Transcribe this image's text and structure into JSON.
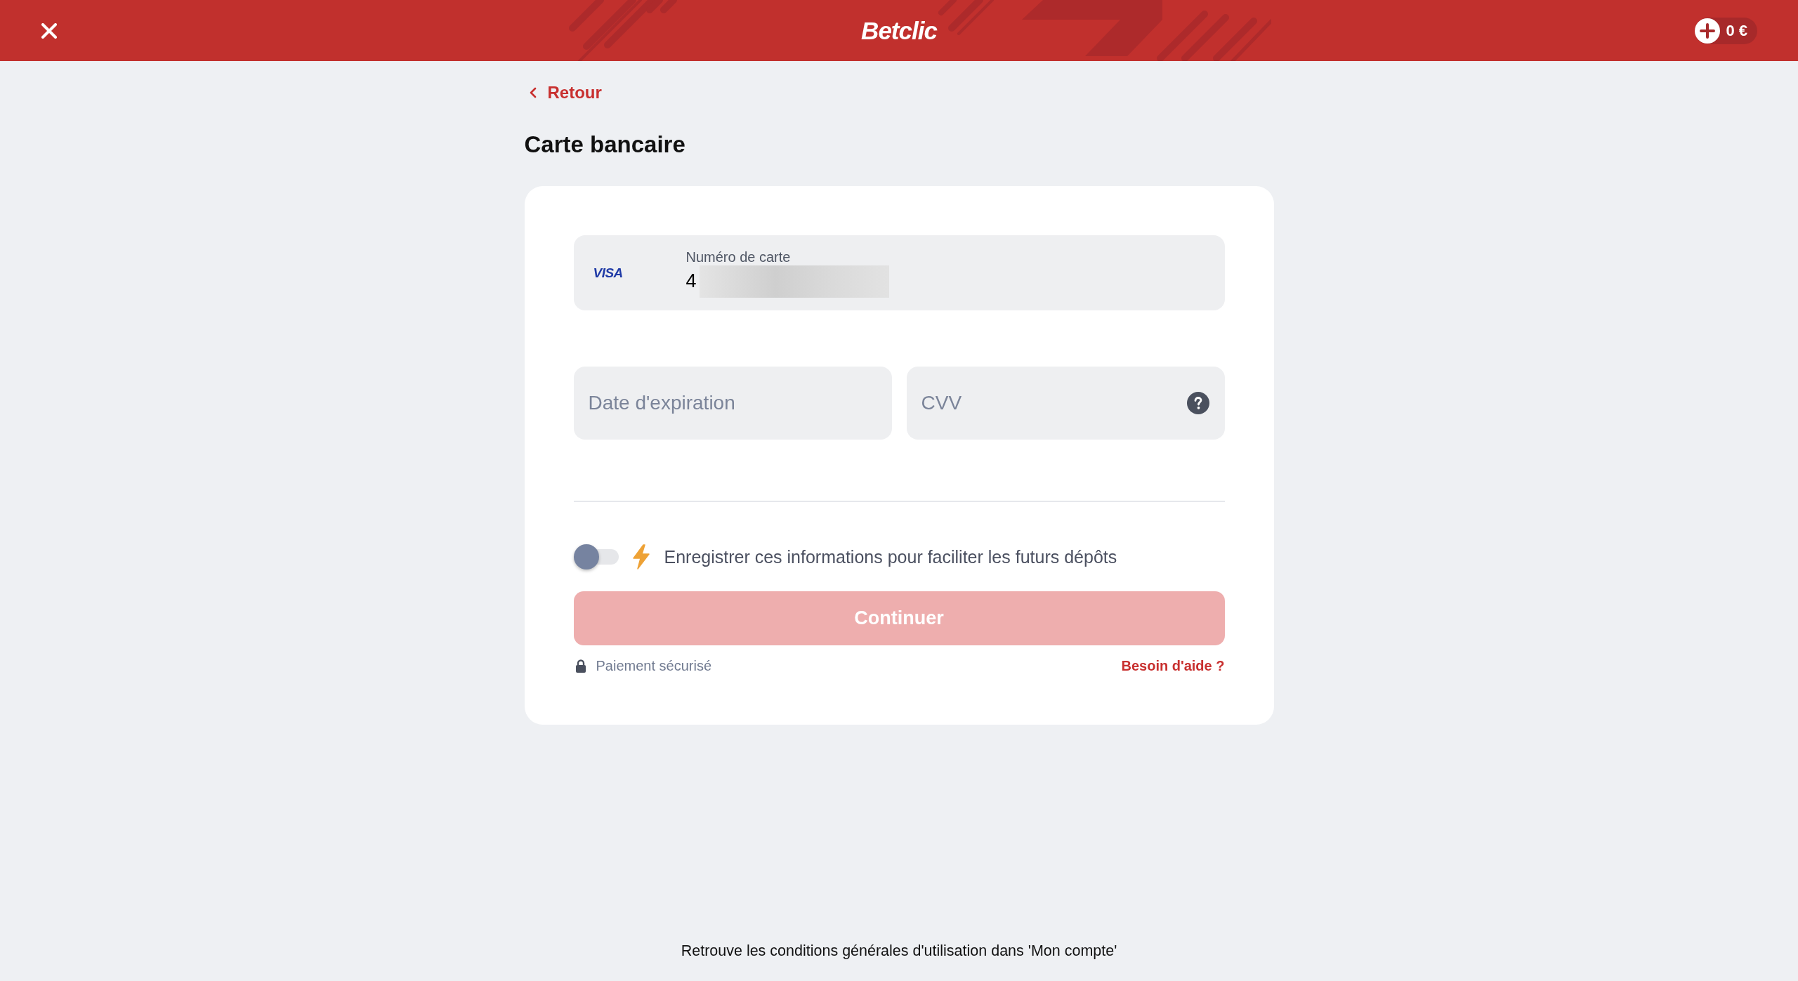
{
  "header": {
    "logo": "Betclic",
    "balance": "0 €"
  },
  "back_link": {
    "label": "Retour"
  },
  "title": "Carte bancaire",
  "card_form": {
    "card_number": {
      "brand": "VISA",
      "label": "Numéro de carte",
      "value": "4"
    },
    "expiry": {
      "placeholder": "Date d'expiration"
    },
    "cvv": {
      "placeholder": "CVV"
    },
    "save_info": {
      "label": "Enregistrer ces informations pour faciliter les futurs dépôts",
      "on": false
    },
    "submit": {
      "label": "Continuer",
      "disabled": true
    },
    "secure_note": "Paiement sécurisé",
    "help_link": "Besoin d'aide ?"
  },
  "footer": "Retrouve les conditions générales d'utilisation dans 'Mon compte'"
}
